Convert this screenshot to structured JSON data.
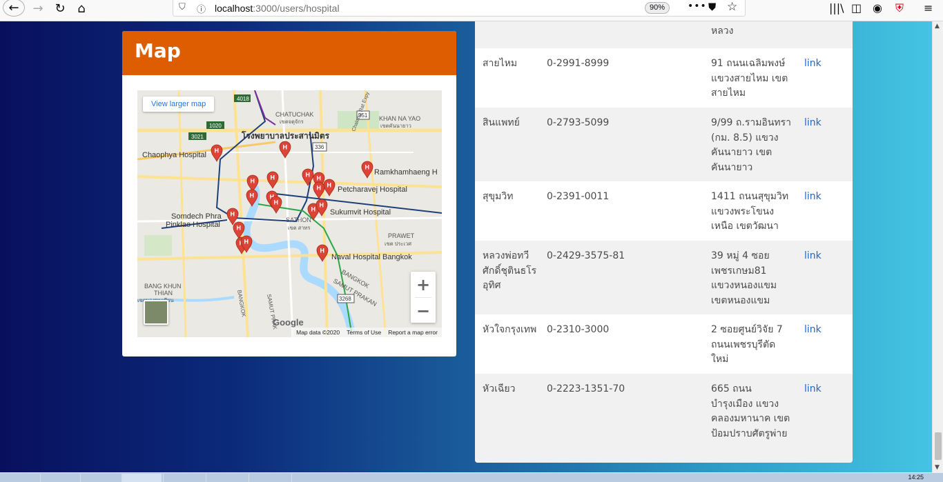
{
  "browser": {
    "url_host": "localhost",
    "url_path": ":3000/users/hospital",
    "zoom": "90%"
  },
  "map": {
    "title": "Map",
    "view_larger": "View larger map",
    "zoom_in": "+",
    "zoom_out": "−",
    "google": "Google",
    "footer": {
      "data": "Map data ©2020",
      "terms": "Terms of Use",
      "report": "Report a map error"
    },
    "labels": [
      {
        "id": "chatuchak",
        "text": "CHATUCHAK"
      },
      {
        "id": "chatuchak-th",
        "text": "เขตจตุจักร"
      },
      {
        "id": "khan-na-yao",
        "text": "KHAN NA YAO"
      },
      {
        "id": "khan-na-yao-th",
        "text": "เขตคันนายาว"
      },
      {
        "id": "prasanmitr",
        "text": "โรงพยาบาลประสานมิตร"
      },
      {
        "id": "chaophya",
        "text": "Chaophya Hospital"
      },
      {
        "id": "ramkhamhaeng",
        "text": "Ramkhamhaeng H"
      },
      {
        "id": "petcharavej",
        "text": "Petcharavej Hospital"
      },
      {
        "id": "sukumvit",
        "text": "Sukumvit Hospital"
      },
      {
        "id": "somdech1",
        "text": "Somdech Phra"
      },
      {
        "id": "somdech2",
        "text": "Pinklao Hospital"
      },
      {
        "id": "sathon",
        "text": "SATHON"
      },
      {
        "id": "sathon-th",
        "text": "เขต สาทร"
      },
      {
        "id": "prawet",
        "text": "PRAWET"
      },
      {
        "id": "prawet-th",
        "text": "เขต ประเวศ"
      },
      {
        "id": "naval",
        "text": "Naval Hospital Bangkok"
      },
      {
        "id": "bangkok1",
        "text": "BANGKOK"
      },
      {
        "id": "samut1",
        "text": "SAMUT PRAKAN"
      },
      {
        "id": "bangkhun",
        "text": "BANG KHUN"
      },
      {
        "id": "thian",
        "text": "THIAN"
      },
      {
        "id": "bangkhun-th",
        "text": "เขตบางขุนเทียน"
      },
      {
        "id": "bangkok2",
        "text": "BANGKOK"
      },
      {
        "id": "samut2",
        "text": "SAMUT PRAK"
      },
      {
        "id": "chalong",
        "text": "Chalong Rat Expy"
      },
      {
        "id": "shield-351",
        "text": "351"
      },
      {
        "id": "shield-336",
        "text": "336"
      },
      {
        "id": "shield-3268",
        "text": "3268"
      },
      {
        "id": "shield-1020",
        "text": "1020"
      },
      {
        "id": "shield-3021",
        "text": "3021"
      },
      {
        "id": "shield-4018",
        "text": "4018"
      }
    ]
  },
  "hospitals": [
    {
      "name": "",
      "phone": "",
      "address": "หลวง",
      "link": ""
    },
    {
      "name": "สายไหม",
      "phone": "0-2991-8999",
      "address": "91 ถนนเฉลิมพงษ์ แขวงสายไหม เขตสายไหม",
      "link": "link"
    },
    {
      "name": "สินแพทย์",
      "phone": "0-2793-5099",
      "address": "9/99 ถ.รามอินทรา (กม. 8.5) แขวงคันนายาว เขตคันนายาว",
      "link": "link"
    },
    {
      "name": "สุขุมวิท",
      "phone": "0-2391-0011",
      "address": "1411 ถนนสุขุมวิท แขวงพระโขนงเหนือ เขตวัฒนา",
      "link": "link"
    },
    {
      "name": "หลวงพ่อทวีศักดิ์ชุตินธโรอุทิศ",
      "phone": "0-2429-3575-81",
      "address": "39 หมู่ 4 ซอยเพชรเกษม81 แขวงหนองแขม เขตหนองแขม",
      "link": "link"
    },
    {
      "name": "หัวใจกรุงเทพ",
      "phone": "0-2310-3000",
      "address": "2 ซอยศูนย์วิจัย 7 ถนนเพชรบุรีตัดใหม่",
      "link": "link"
    },
    {
      "name": "หัวเฉียว",
      "phone": "0-2223-1351-70",
      "address": "665 ถนนบำรุงเมือง แขวงคลองมหานาค เขตป้อมปราบศัตรูพ่าย",
      "link": "link"
    }
  ],
  "taskbar": {
    "time": "14:25"
  }
}
